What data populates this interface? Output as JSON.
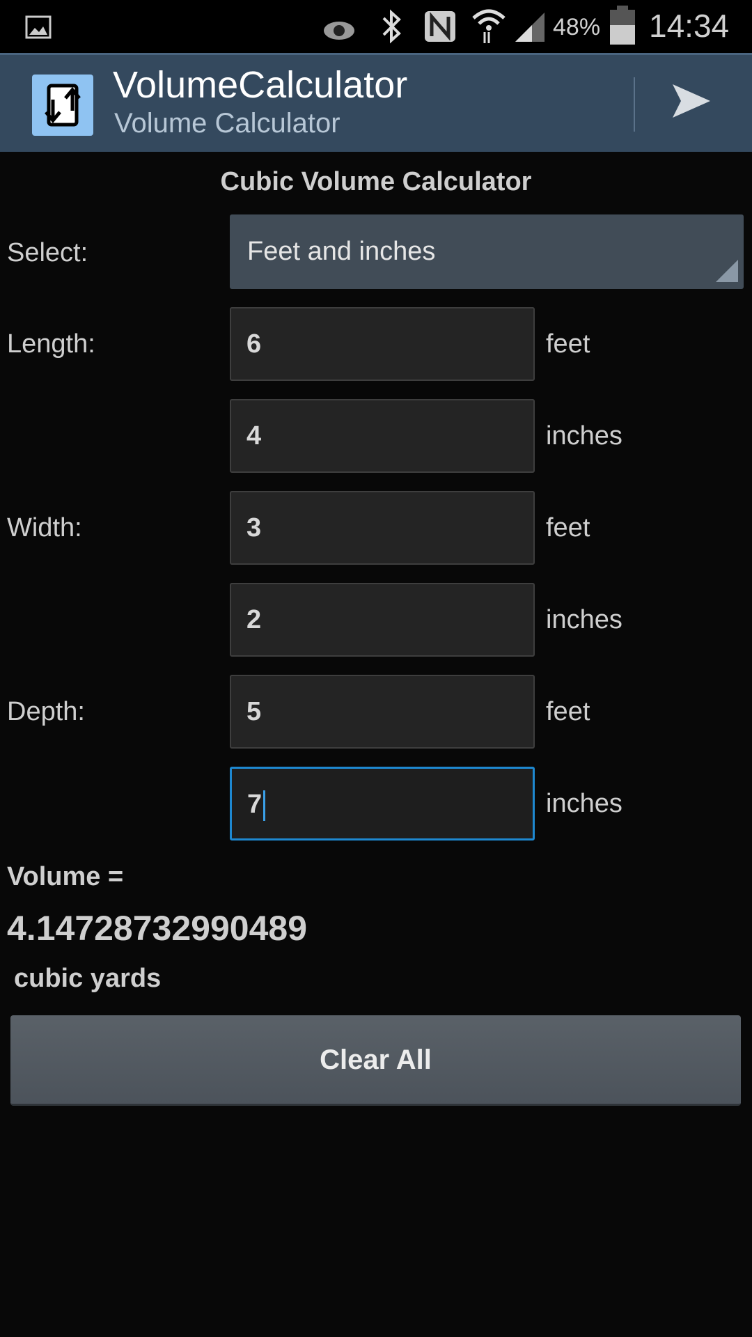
{
  "status_bar": {
    "battery": "48%",
    "time": "14:34",
    "icons": [
      "gallery-icon",
      "eye-icon",
      "bluetooth-icon",
      "nfc-icon",
      "wifi-icon",
      "signal-icon",
      "battery-icon"
    ]
  },
  "app_bar": {
    "title": "VolumeCalculator",
    "subtitle": "Volume Calculator",
    "action_icon": "send-icon",
    "color": "#34495e"
  },
  "main": {
    "heading": "Cubic Volume Calculator",
    "select_label": "Select:",
    "select_value": "Feet and inches",
    "rows": [
      {
        "label": "Length:",
        "value": "6",
        "unit": "feet"
      },
      {
        "label": "",
        "value": "4",
        "unit": "inches"
      },
      {
        "label": "Width:",
        "value": "3",
        "unit": "feet"
      },
      {
        "label": "",
        "value": "2",
        "unit": "inches"
      },
      {
        "label": "Depth:",
        "value": "5",
        "unit": "feet"
      },
      {
        "label": "",
        "value": "7",
        "unit": "inches"
      }
    ],
    "result_label": "Volume =",
    "result_value": "4.14728732990489",
    "result_unit": "cubic yards",
    "clear_button": "Clear All",
    "focus_color": "#1e88d0"
  }
}
